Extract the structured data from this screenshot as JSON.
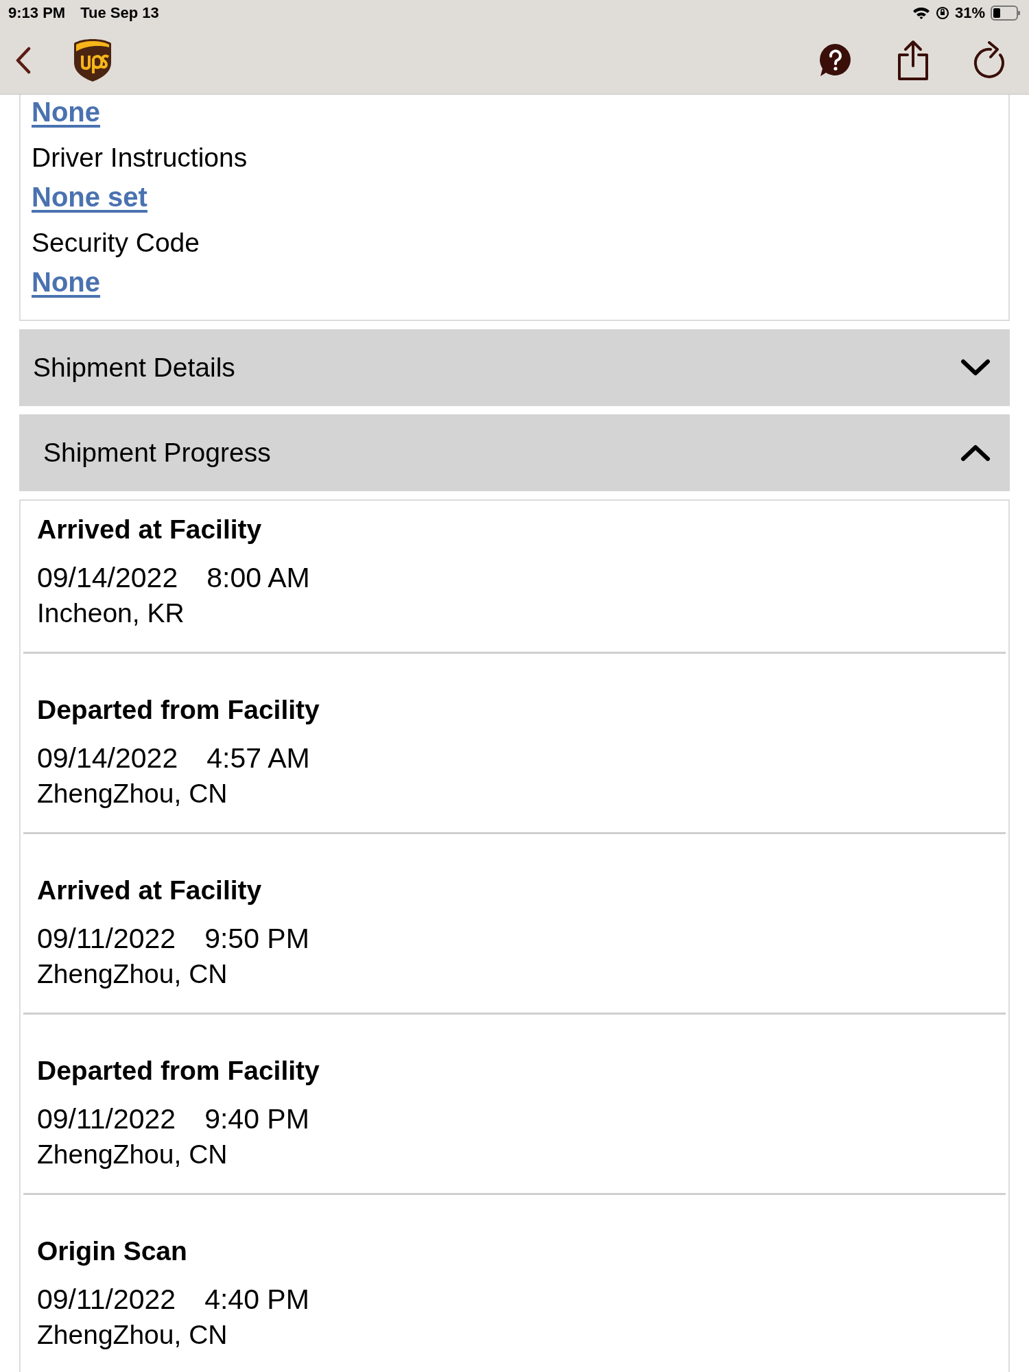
{
  "status_bar": {
    "time": "9:13 PM",
    "date": "Tue Sep 13",
    "battery": "31%"
  },
  "delivery_info": [
    {
      "value": "None"
    },
    {
      "label": "Driver Instructions",
      "value": "None set"
    },
    {
      "label": "Security Code",
      "value": "None"
    }
  ],
  "sections": [
    {
      "title": "Shipment Details",
      "expanded": false
    },
    {
      "title": "Shipment Progress",
      "expanded": true
    }
  ],
  "progress": [
    {
      "status": "Arrived at Facility",
      "date": "09/14/2022",
      "time": "8:00 AM",
      "location": "Incheon, KR"
    },
    {
      "status": "Departed from Facility",
      "date": "09/14/2022",
      "time": "4:57 AM",
      "location": "ZhengZhou, CN"
    },
    {
      "status": "Arrived at Facility",
      "date": "09/11/2022",
      "time": "9:50 PM",
      "location": "ZhengZhou, CN"
    },
    {
      "status": "Departed from Facility",
      "date": "09/11/2022",
      "time": "9:40 PM",
      "location": "ZhengZhou, CN"
    },
    {
      "status": "Origin Scan",
      "date": "09/11/2022",
      "time": "4:40 PM",
      "location": "ZhengZhou, CN"
    }
  ]
}
